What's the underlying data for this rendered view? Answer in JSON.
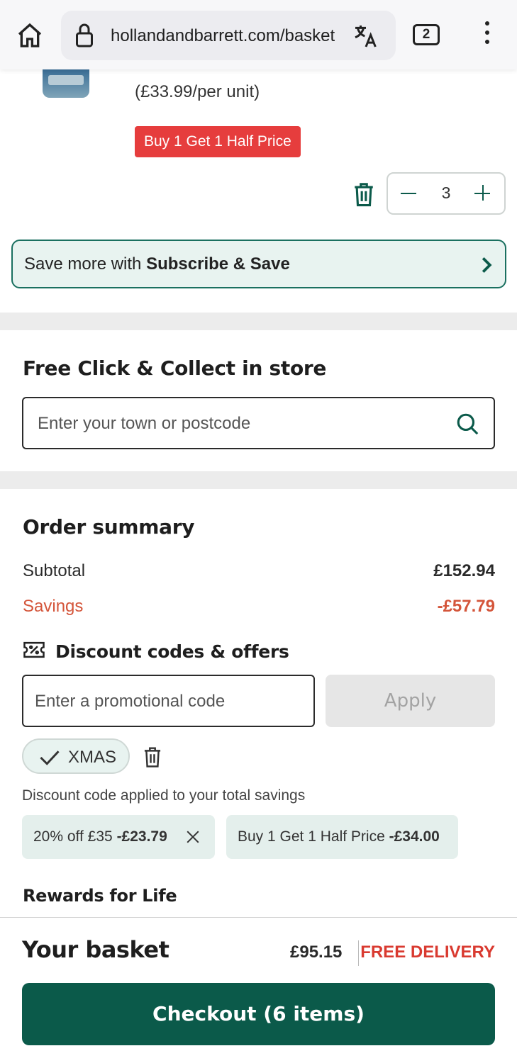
{
  "browser": {
    "url": "hollandandbarrett.com/basket",
    "tab_count": "2",
    "icons": [
      "home-icon",
      "lock-icon",
      "translate-icon",
      "more-vert-icon"
    ]
  },
  "product": {
    "unit_price": "(£33.99/per unit)",
    "promo_badge": "Buy 1 Get 1 Half Price",
    "quantity": "3"
  },
  "subscribe": {
    "text_prefix": "Save more with ",
    "text_bold": "Subscribe & Save"
  },
  "click_collect": {
    "title": "Free Click & Collect in store",
    "search_placeholder": "Enter your town or postcode"
  },
  "order_summary": {
    "title": "Order summary",
    "subtotal_label": "Subtotal",
    "subtotal_value": "£152.94",
    "savings_label": "Savings",
    "savings_value": "-£57.79",
    "discount_title": "Discount codes & offers",
    "promo_placeholder": "Enter a promotional code",
    "apply_label": "Apply",
    "applied_code": "XMAS",
    "applied_note": "Discount code applied to your total savings",
    "offers": [
      {
        "label": "20% off £35",
        "amount": "-£23.79"
      },
      {
        "label": "Buy 1 Get 1 Half Price",
        "amount": "-£34.00"
      }
    ],
    "rewards_title": "Rewards for Life"
  },
  "footer": {
    "basket_label": "Your basket",
    "total": "£95.15",
    "delivery": "FREE DELIVERY",
    "checkout_label": "Checkout (6 items)"
  },
  "colors": {
    "brand_green": "#0b5a4a",
    "savings_red": "#d4553a",
    "promo_red": "#e63d3d",
    "tag_bg": "#e4efec"
  }
}
